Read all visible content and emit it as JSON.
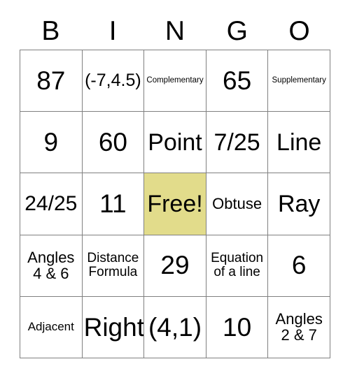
{
  "card": {
    "title": "BINGO",
    "header_letters": [
      "B",
      "I",
      "N",
      "G",
      "O"
    ],
    "free_space_color": "#e2dc8b",
    "grid_line_color": "#808080",
    "rows": [
      [
        {
          "text": "87",
          "size": "xxl",
          "free": false
        },
        {
          "text": "(-7,4.5)",
          "size": "m",
          "free": false
        },
        {
          "text": "Complementary",
          "size": "tiny",
          "free": false
        },
        {
          "text": "65",
          "size": "xxl",
          "free": false
        },
        {
          "text": "Supplementary",
          "size": "tiny",
          "free": false
        }
      ],
      [
        {
          "text": "9",
          "size": "xxl",
          "free": false
        },
        {
          "text": "60",
          "size": "xxl",
          "free": false
        },
        {
          "text": "Point",
          "size": "xl",
          "free": false
        },
        {
          "text": "7/25",
          "size": "xl",
          "free": false
        },
        {
          "text": "Line",
          "size": "xl",
          "free": false
        }
      ],
      [
        {
          "text": "24/25",
          "size": "l",
          "free": false
        },
        {
          "text": "11",
          "size": "xxl",
          "free": false
        },
        {
          "text": "Free!",
          "size": "xl",
          "free": true
        },
        {
          "text": "Obtuse",
          "size": "s",
          "free": false
        },
        {
          "text": "Ray",
          "size": "xl",
          "free": false
        }
      ],
      [
        {
          "text": "Angles 4 & 6",
          "size": "s",
          "free": false
        },
        {
          "text": "Distance Formula",
          "size": "xs",
          "free": false
        },
        {
          "text": "29",
          "size": "xxl",
          "free": false
        },
        {
          "text": "Equation of a line",
          "size": "xs",
          "free": false
        },
        {
          "text": "6",
          "size": "xxl",
          "free": false
        }
      ],
      [
        {
          "text": "Adjacent",
          "size": "xxs",
          "free": false
        },
        {
          "text": "Right",
          "size": "xxl",
          "free": false
        },
        {
          "text": "(4,1)",
          "size": "xxl",
          "free": false
        },
        {
          "text": "10",
          "size": "xxl",
          "free": false
        },
        {
          "text": "Angles 2 & 7",
          "size": "s",
          "free": false
        }
      ]
    ]
  }
}
